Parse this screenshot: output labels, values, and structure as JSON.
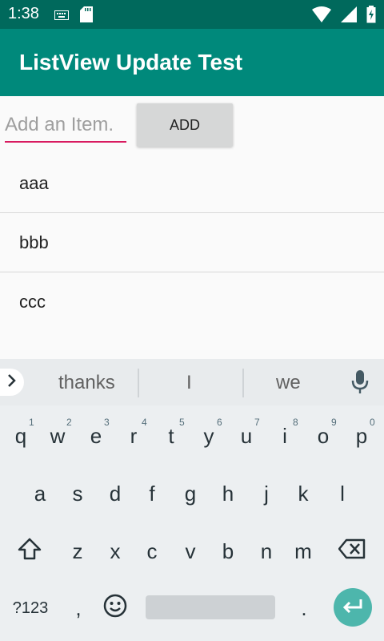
{
  "status_bar": {
    "time": "1:38",
    "icons": [
      "keyboard-icon",
      "sd-card-icon",
      "wifi-icon",
      "signal-icon",
      "battery-icon"
    ]
  },
  "app_bar": {
    "title": "ListView Update Test"
  },
  "form": {
    "input_placeholder": "Add an Item.",
    "input_value": "",
    "add_label": "ADD"
  },
  "list": {
    "items": [
      "aaa",
      "bbb",
      "ccc"
    ]
  },
  "keyboard": {
    "suggestions": [
      "thanks",
      "I",
      "we"
    ],
    "row1": [
      "q",
      "w",
      "e",
      "r",
      "t",
      "y",
      "u",
      "i",
      "o",
      "p"
    ],
    "row1_hints": [
      "1",
      "2",
      "3",
      "4",
      "5",
      "6",
      "7",
      "8",
      "9",
      "0"
    ],
    "row2": [
      "a",
      "s",
      "d",
      "f",
      "g",
      "h",
      "j",
      "k",
      "l"
    ],
    "row3": [
      "z",
      "x",
      "c",
      "v",
      "b",
      "n",
      "m"
    ],
    "symbols_label": "?123",
    "comma_label": ",",
    "period_label": "."
  },
  "colors": {
    "status_bar": "#00695c",
    "app_bar": "#00897b",
    "input_underline": "#d81b60",
    "enter_key": "#4db6ac"
  }
}
